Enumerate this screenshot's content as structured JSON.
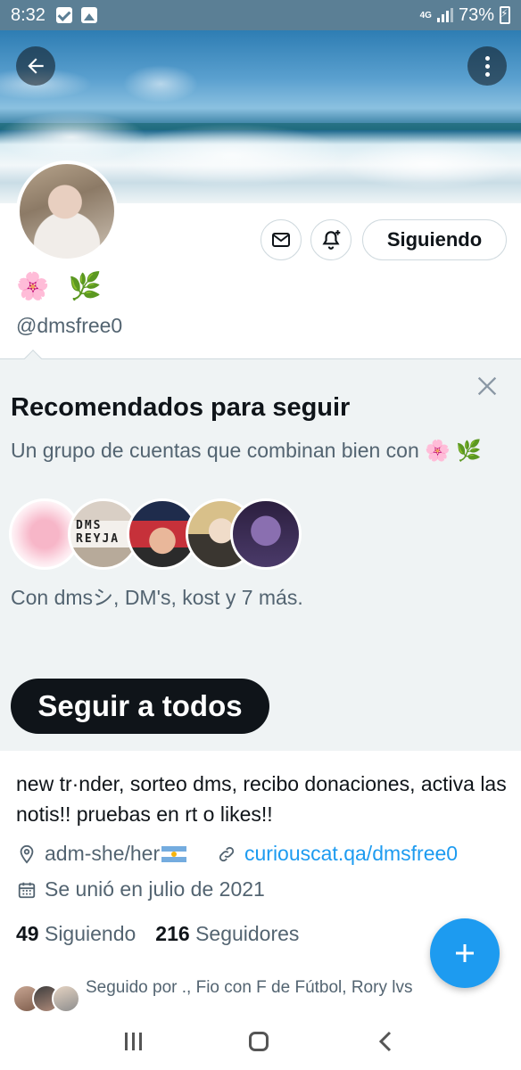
{
  "status_bar": {
    "time": "8:32",
    "network": "4G",
    "battery": "73%"
  },
  "profile": {
    "name_emojis": "🌸 🌿",
    "handle": "@dmsfree0",
    "follow_button": "Siguiendo",
    "bio": "new tr·nder, sorteo dms, recibo donaciones, activa las notis!! pruebas en rt o likes!!",
    "location": "adm-she/her",
    "link": "curiouscat.qa/dmsfree0",
    "joined": "Se unió en julio de 2021",
    "following_count": "49",
    "following_label": "Siguiendo",
    "followers_count": "216",
    "followers_label": "Seguidores",
    "followed_by": "Seguido por ., Fio con F de Fútbol, Rory lvs"
  },
  "recommendations": {
    "title": "Recomendados para seguir",
    "description": "Un grupo de cuentas que combinan bien con 🌸 🌿",
    "avatar_text": "DMS REYJA",
    "summary": "Con dmsシ, DM's, kost y 7 más.",
    "follow_all_label": "Seguir a todos"
  },
  "colors": {
    "accent": "#1d9bf0",
    "text_primary": "#0f1419",
    "text_secondary": "#536471",
    "panel_bg": "#eff3f4",
    "status_bar_bg": "#5b7f95"
  },
  "icons": {
    "back": "arrow-left-icon",
    "more": "more-vertical-icon",
    "mail": "mail-icon",
    "notifications": "bell-plus-icon",
    "close": "close-icon",
    "location": "location-pin-icon",
    "link": "link-icon",
    "calendar": "calendar-icon",
    "compose": "plus-icon"
  }
}
